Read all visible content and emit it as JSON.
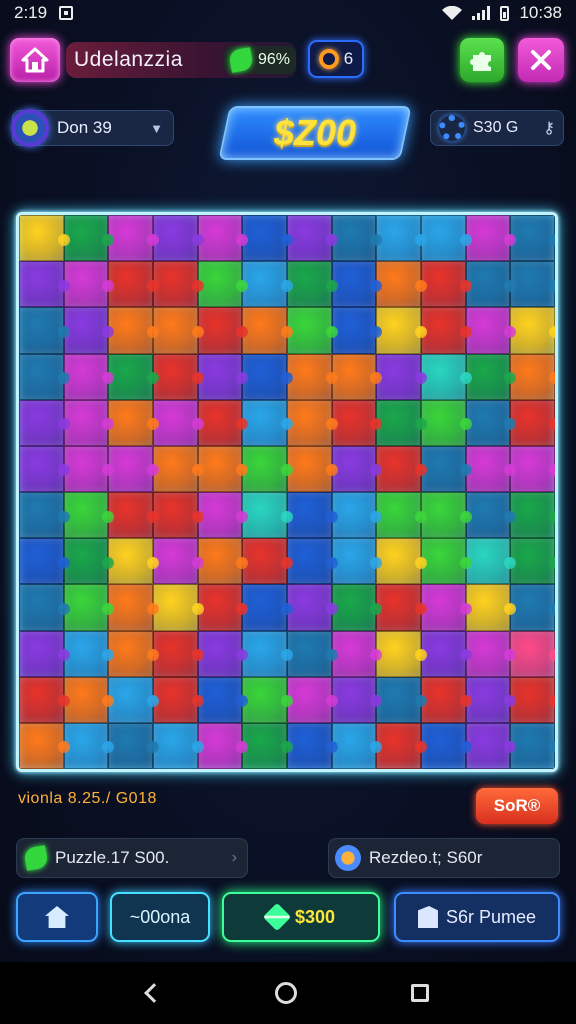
{
  "status_bar": {
    "time": "2:19",
    "clock": "10:38"
  },
  "header": {
    "title": "Udelanzzia",
    "score": "96%",
    "coins": "6"
  },
  "controls": {
    "difficulty_value": "Don 39",
    "balance": "$Z00",
    "right_value": "S30 G"
  },
  "board": {
    "rows": 12,
    "cols": 12,
    "palette": [
      "#e8332a",
      "#ff7a1a",
      "#ffd21f",
      "#3ad63a",
      "#1aa84a",
      "#2aa6e8",
      "#1f5fd6",
      "#8a3ae0",
      "#d63ad6",
      "#1e7ab0",
      "#2ad6c0",
      "#ff4a8a"
    ],
    "cells": [
      2,
      4,
      8,
      7,
      8,
      6,
      7,
      9,
      5,
      5,
      8,
      9,
      7,
      8,
      0,
      0,
      3,
      5,
      4,
      6,
      1,
      0,
      9,
      9,
      9,
      7,
      1,
      1,
      0,
      1,
      3,
      6,
      2,
      0,
      8,
      2,
      9,
      8,
      4,
      0,
      7,
      6,
      1,
      1,
      7,
      10,
      4,
      1,
      7,
      8,
      1,
      8,
      0,
      5,
      1,
      0,
      4,
      3,
      9,
      0,
      7,
      8,
      8,
      1,
      1,
      3,
      1,
      7,
      0,
      9,
      8,
      8,
      9,
      3,
      0,
      0,
      8,
      10,
      6,
      5,
      3,
      3,
      9,
      4,
      6,
      4,
      2,
      8,
      1,
      0,
      6,
      5,
      2,
      3,
      10,
      4,
      9,
      3,
      1,
      2,
      0,
      6,
      7,
      4,
      0,
      8,
      2,
      9,
      7,
      5,
      1,
      0,
      7,
      5,
      9,
      8,
      2,
      7,
      8,
      11,
      0,
      1,
      5,
      0,
      6,
      3,
      8,
      7,
      9,
      0,
      7,
      0,
      1,
      5,
      9,
      5,
      8,
      4,
      6,
      5,
      0,
      6,
      7,
      9
    ]
  },
  "footer": {
    "level_text": "vionla 8.25./ G018",
    "score_button": "SoR®",
    "info_left": "Puzzle.17 S00.",
    "info_right": "Rezdeo.t; S60r",
    "btn_zoom": "~00ona",
    "btn_buy": "$300",
    "btn_share": "S6r Pumee"
  },
  "colors": {
    "accent_pink": "#f25ad9",
    "accent_green": "#45ff3a",
    "accent_blue": "#3aa0ff",
    "money_yellow": "#ffe33a",
    "level_orange": "#ffb238"
  }
}
